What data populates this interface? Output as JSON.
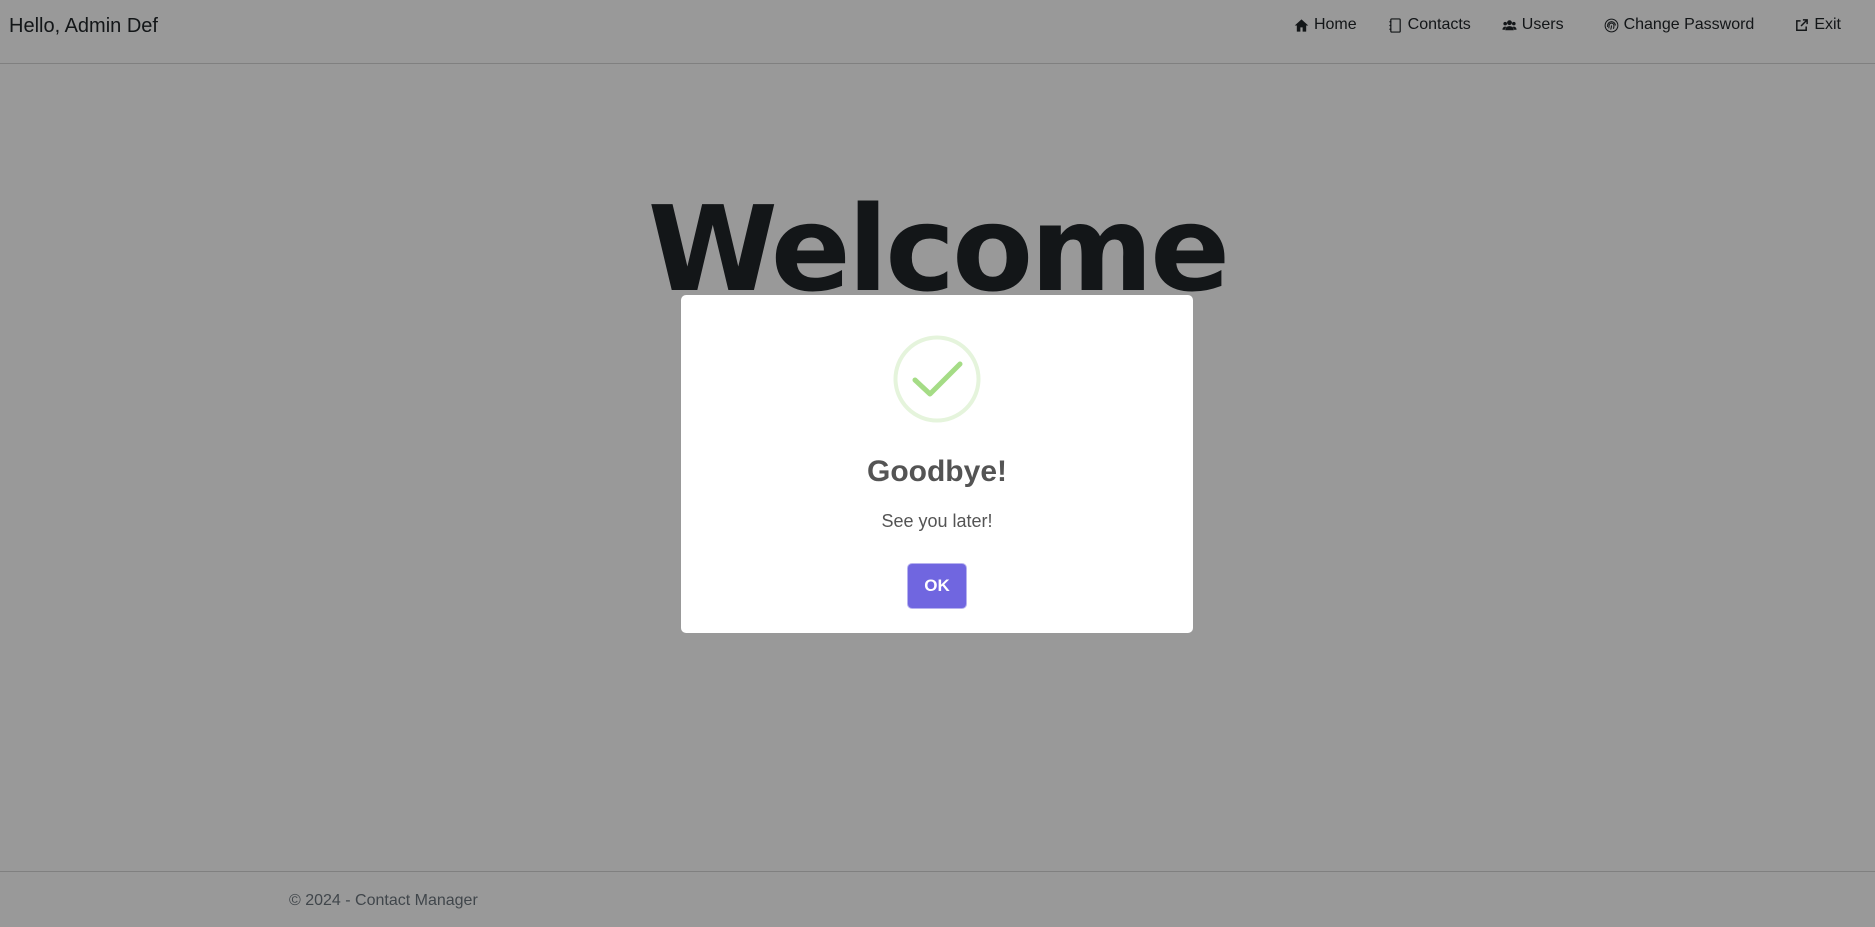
{
  "header": {
    "greeting": "Hello, Admin Def",
    "nav": [
      {
        "label": "Home",
        "icon": "home-icon"
      },
      {
        "label": "Contacts",
        "icon": "address-book-icon"
      },
      {
        "label": "Users",
        "icon": "users-icon"
      },
      {
        "label": "Change Password",
        "icon": "fingerprint-icon"
      },
      {
        "label": "Exit",
        "icon": "external-link-icon"
      }
    ]
  },
  "main": {
    "heading": "Welcome"
  },
  "footer": {
    "text": "© 2024 - Contact Manager"
  },
  "dialog": {
    "icon": "success-check-icon",
    "title": "Goodbye!",
    "message": "See you later!",
    "confirm_label": "OK"
  },
  "colors": {
    "overlay": "rgba(0,0,0,0.4)",
    "confirm_button": "#7066e0",
    "success_icon": "#a5dc86",
    "success_ring": "#e5f4dc",
    "text": "#545454"
  }
}
